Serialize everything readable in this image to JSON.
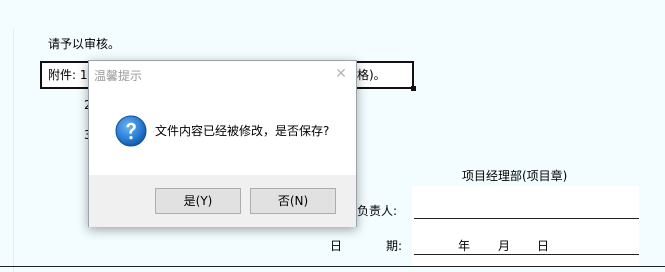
{
  "document": {
    "review_request": "请予以审核。",
    "attachment_line": "附件: 1",
    "attachment_tail": "格)。",
    "list_number_2": "2",
    "list_number_3": "3",
    "project_dept": "项目经理部(项目章)",
    "responsible_label": "负责人:",
    "date_label_left": "日",
    "date_label_right": "期:",
    "year": "年",
    "month": "月",
    "day": "日"
  },
  "dialog": {
    "title": "温馨提示",
    "close_glyph": "✕",
    "icon": "question-icon",
    "message": "文件内容已经被修改，是否保存?",
    "yes_label": "是(Y)",
    "no_label": "否(N)"
  },
  "colors": {
    "doc_background": "#f3fdff",
    "dialog_footer": "#f0f0f0",
    "icon_blue": "#1f6fc9"
  }
}
